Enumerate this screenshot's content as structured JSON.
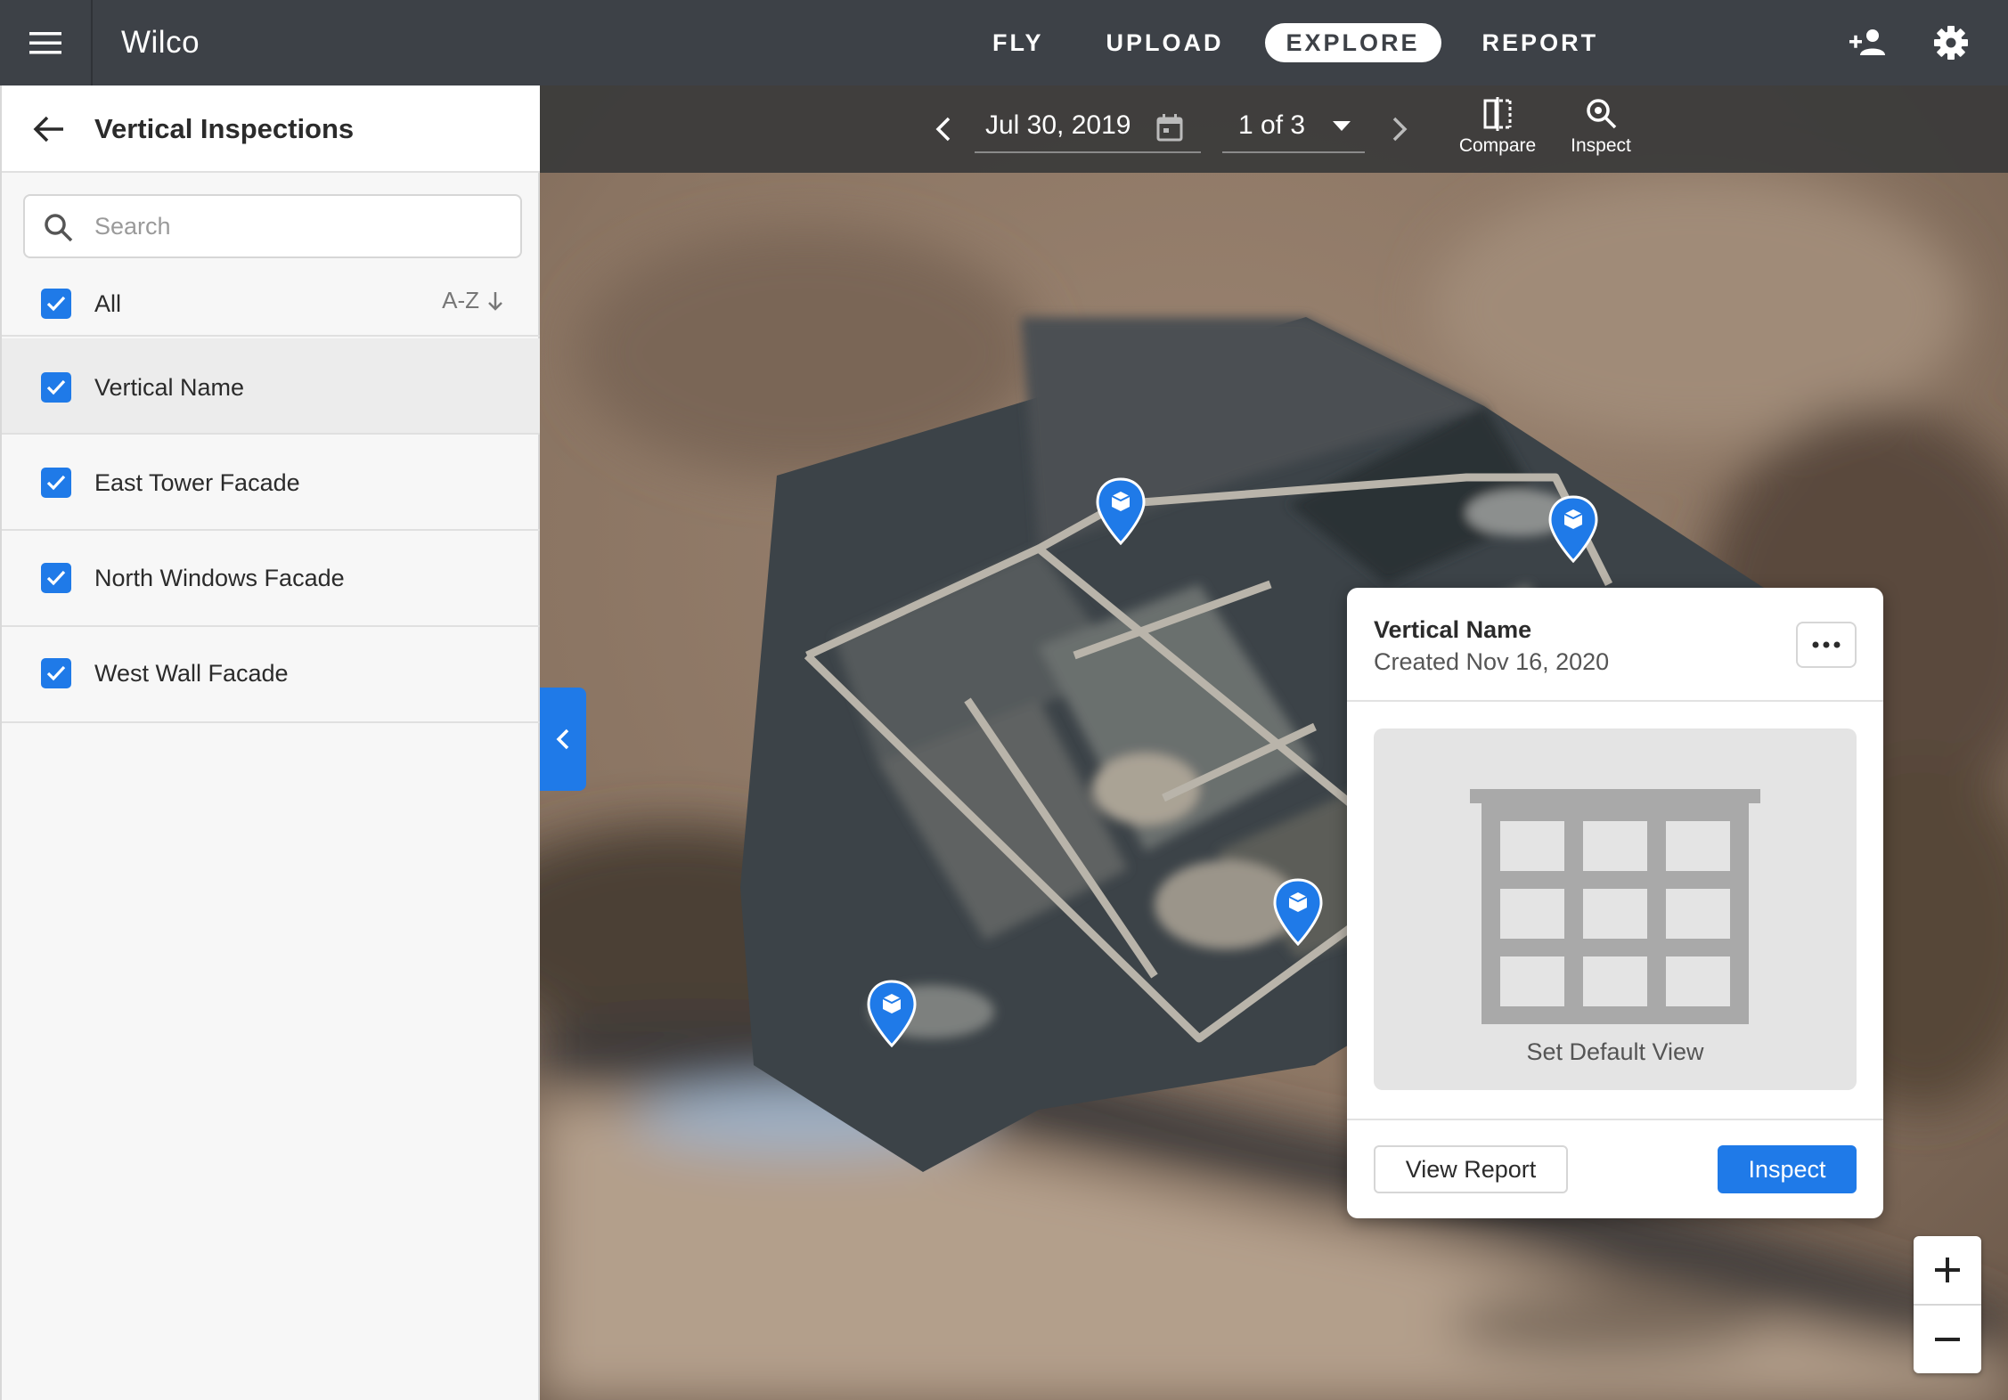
{
  "app": {
    "title": "Wilco"
  },
  "nav": {
    "tabs": [
      "FLY",
      "UPLOAD",
      "EXPLORE",
      "REPORT"
    ],
    "active": "EXPLORE"
  },
  "sidebar": {
    "title": "Vertical Inspections",
    "search": {
      "placeholder": "Search",
      "value": ""
    },
    "all_label": "All",
    "sort_label": "A-Z",
    "items": [
      {
        "label": "Vertical Name",
        "checked": true,
        "selected": true
      },
      {
        "label": "East Tower Facade",
        "checked": true,
        "selected": false
      },
      {
        "label": "North Windows Facade",
        "checked": true,
        "selected": false
      },
      {
        "label": "West Wall Facade",
        "checked": true,
        "selected": false
      }
    ]
  },
  "toolbar": {
    "date": "Jul 30, 2019",
    "page": "1 of 3",
    "compare_label": "Compare",
    "inspect_label": "Inspect"
  },
  "popup": {
    "title": "Vertical Name",
    "subtitle": "Created Nov 16, 2020",
    "preview_label": "Set Default View",
    "view_report_label": "View Report",
    "inspect_label": "Inspect"
  },
  "colors": {
    "accent": "#1f7ae8",
    "topbar": "#3d4147",
    "toolbar": "#3a3a3a"
  },
  "icons": [
    "menu-icon",
    "add-person-icon",
    "settings-icon",
    "back-arrow-icon",
    "search-icon",
    "check-icon",
    "sort-down-icon",
    "chevron-left-icon",
    "calendar-icon",
    "dropdown-caret-icon",
    "chevron-right-icon",
    "compare-icon",
    "inspect-magnifier-icon",
    "map-pin-icon",
    "more-horizontal-icon",
    "building-icon",
    "zoom-in-icon",
    "zoom-out-icon"
  ]
}
